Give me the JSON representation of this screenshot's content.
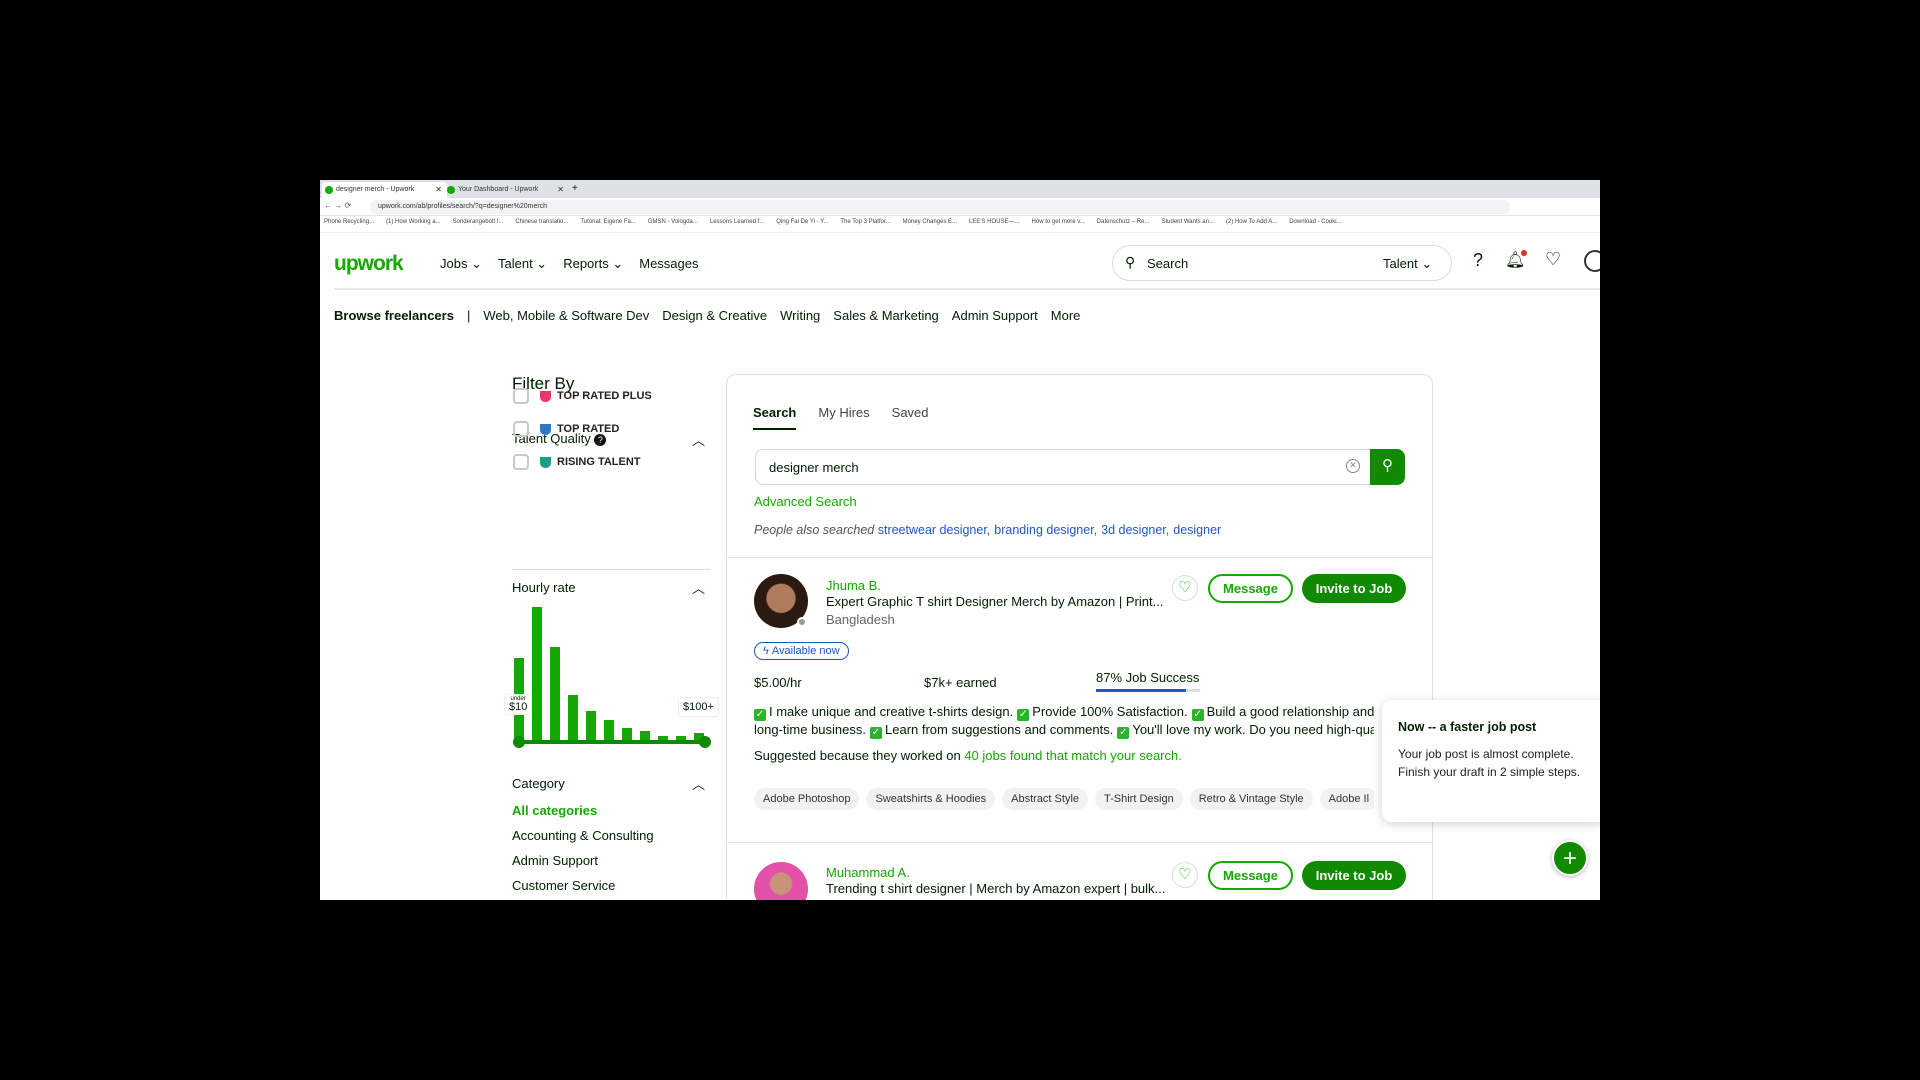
{
  "browser": {
    "tabs": [
      {
        "label": "designer merch - Upwork",
        "active": true
      },
      {
        "label": "Your Dashboard - Upwork",
        "active": false
      }
    ],
    "new_tab": "+",
    "url": "upwork.com/ab/profiles/search/?q=designer%20merch",
    "bookmarks": [
      "Phone Recycling...",
      "(1) How Working a...",
      "Sonderangebot! l...",
      "Chinese translatio...",
      "Tutorial: Eigene Fa...",
      "GMSN - Vologda...",
      "Lessons Learned f...",
      "Qing Fai De Yi - Y...",
      "The Top 3 Platfor...",
      "Money Changes E...",
      "LEE'S HOUSE—...",
      "How to get more v...",
      "Datenschutz – Re...",
      "Student Wants an...",
      "(2) How To Add A...",
      "Download - Cooki..."
    ]
  },
  "header": {
    "logo": "upwork",
    "nav": [
      "Jobs",
      "Talent",
      "Reports",
      "Messages"
    ],
    "search_placeholder": "Search",
    "search_scope": "Talent",
    "notification_dot_color": "#e0302a"
  },
  "subnav": {
    "items": [
      "Browse freelancers",
      "|",
      "Web, Mobile & Software Dev",
      "Design & Creative",
      "Writing",
      "Sales & Marketing",
      "Admin Support",
      "More"
    ]
  },
  "filters": {
    "title": "Filter By",
    "talent_quality": {
      "label": "Talent Quality",
      "options": [
        {
          "label": "TOP RATED PLUS",
          "color": "#e8386d",
          "checked": false
        },
        {
          "label": "TOP RATED",
          "color": "#2b7bc0",
          "checked": false
        },
        {
          "label": "RISING TALENT",
          "color": "#1a9e86",
          "checked": false
        }
      ]
    },
    "hourly_rate": {
      "label": "Hourly rate",
      "min_label_small": "under",
      "min_label": "$10",
      "max_label": "$100+",
      "histogram_relative_levels": [
        62,
        100,
        70,
        34,
        22,
        15,
        9,
        7,
        3,
        3,
        5
      ],
      "color": "#14a800"
    },
    "category": {
      "label": "Category",
      "items": [
        "All categories",
        "Accounting & Consulting",
        "Admin Support",
        "Customer Service"
      ],
      "selected": "All categories"
    }
  },
  "main": {
    "tabs": [
      "Search",
      "My Hires",
      "Saved"
    ],
    "active_tab": "Search",
    "search_value": "designer merch",
    "advanced_search": "Advanced Search",
    "also_searched_label": "People also searched",
    "also_searched": [
      "streetwear designer,",
      "branding designer,",
      "3d designer,",
      "designer"
    ],
    "results": [
      {
        "name": "Jhuma B.",
        "title": "Expert Graphic T shirt Designer Merch by Amazon | Print...",
        "location": "Bangladesh",
        "available": "Available now",
        "rate": "$5.00/hr",
        "earned": "$7k+ earned",
        "job_success": "87% Job Success",
        "job_success_pct": 87,
        "description_line1": [
          "I make unique and creative t-shirts design.",
          "Provide 100% Satisfaction.",
          "Build a good relationship and"
        ],
        "description_line2": [
          "long-time business.",
          "Learn from suggestions and comments.",
          "You'll love my work. Do you need high-qual"
        ],
        "suggested_prefix": "Suggested because they worked on",
        "suggested_link": "40 jobs found that match your search.",
        "skills": [
          "Adobe Photoshop",
          "Sweatshirts & Hoodies",
          "Abstract Style",
          "T-Shirt Design",
          "Retro & Vintage Style",
          "Adobe Il"
        ],
        "message": "Message",
        "invite": "Invite to Job"
      },
      {
        "name": "Muhammad A.",
        "title": "Trending t shirt designer | Merch by Amazon expert | bulk...",
        "message": "Message",
        "invite": "Invite to Job"
      }
    ]
  },
  "popup": {
    "title": "Now -- a faster job post",
    "body": "Your job post is almost complete. Finish your draft in 2 simple steps."
  },
  "fab": "+",
  "colors": {
    "brand": "#14a800",
    "button": "#108a00",
    "link": "#14a800",
    "also_searched": "#1f57c3"
  }
}
